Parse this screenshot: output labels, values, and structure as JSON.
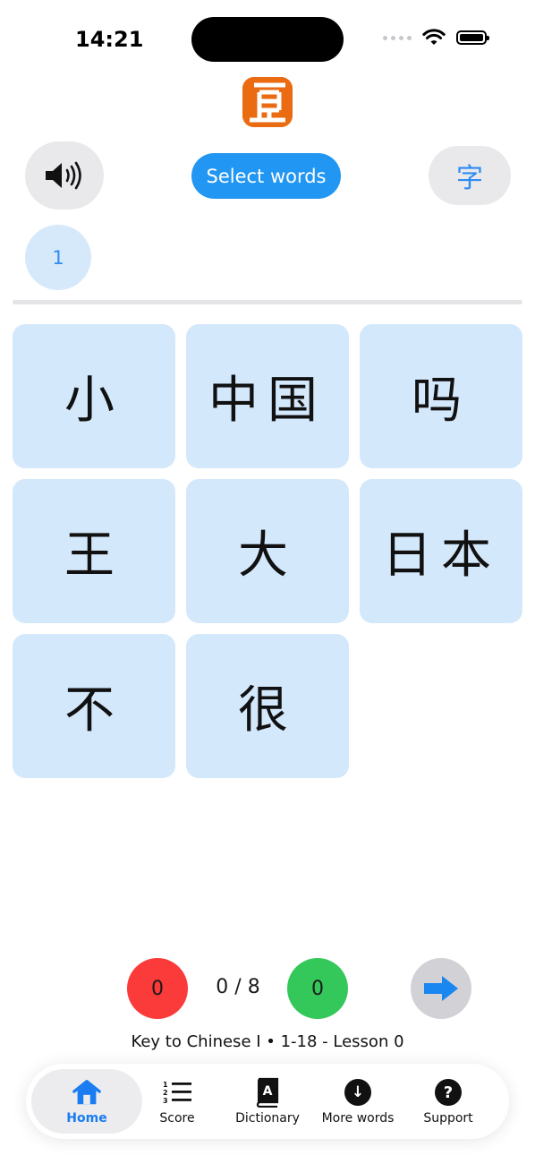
{
  "status_bar": {
    "time": "14:21"
  },
  "toolbar": {
    "select_words_label": "Select words",
    "char_toggle_label": "字"
  },
  "pages": [
    "1"
  ],
  "words": [
    "小",
    "中国",
    "吗",
    "王",
    "大",
    "日本",
    "不",
    "很"
  ],
  "score": {
    "wrong": "0",
    "progress": "0 / 8",
    "correct": "0"
  },
  "lesson_info": "Key to Chinese I • 1-18 - Lesson 0",
  "tabs": {
    "home": "Home",
    "score": "Score",
    "dictionary": "Dictionary",
    "more_words": "More words",
    "support": "Support"
  },
  "colors": {
    "accent": "#2196f3",
    "card": "#d4e8fc",
    "wrong": "#fb3a3a",
    "correct": "#34c759",
    "logo": "#ea6b12"
  }
}
